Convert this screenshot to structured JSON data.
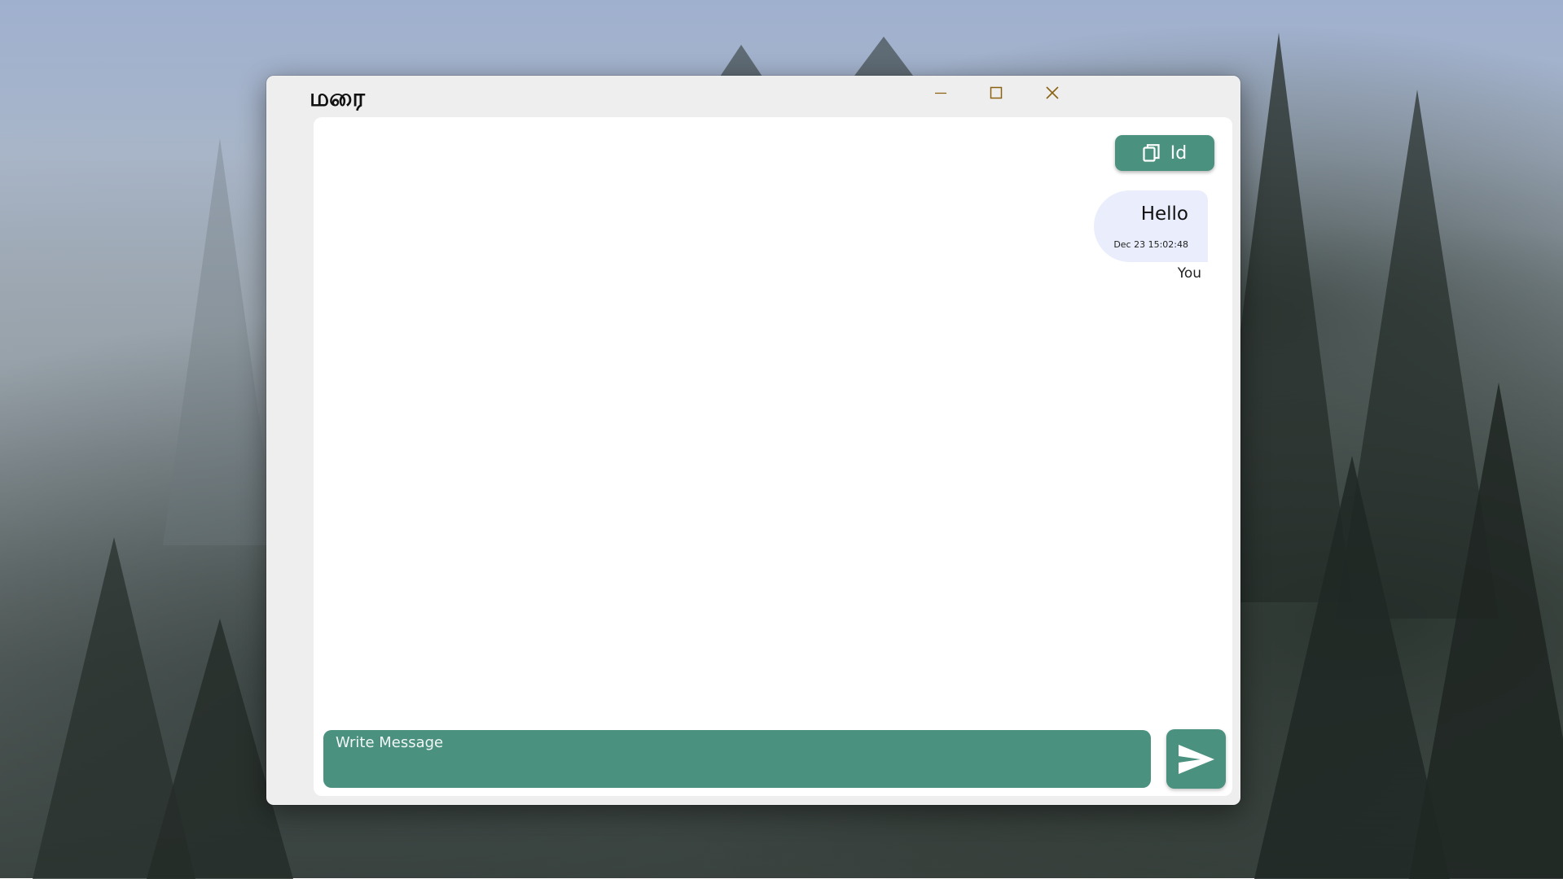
{
  "window": {
    "title": "மரை",
    "controls": {
      "minimize_icon": "minimize-icon",
      "maximize_icon": "maximize-icon",
      "close_icon": "close-icon"
    }
  },
  "toolbar": {
    "id_button_label": "Id",
    "id_button_icon": "copy-icon"
  },
  "messages": [
    {
      "text": "Hello",
      "timestamp": "Dec 23 15:02:48",
      "sender": "You"
    }
  ],
  "composer": {
    "placeholder": "Write Message",
    "value": "",
    "send_icon": "send-icon"
  },
  "colors": {
    "accent": "#4a917f",
    "bubble": "#eaeefc",
    "window_chrome": "#eeeeee",
    "control_icon": "#8a6212"
  }
}
